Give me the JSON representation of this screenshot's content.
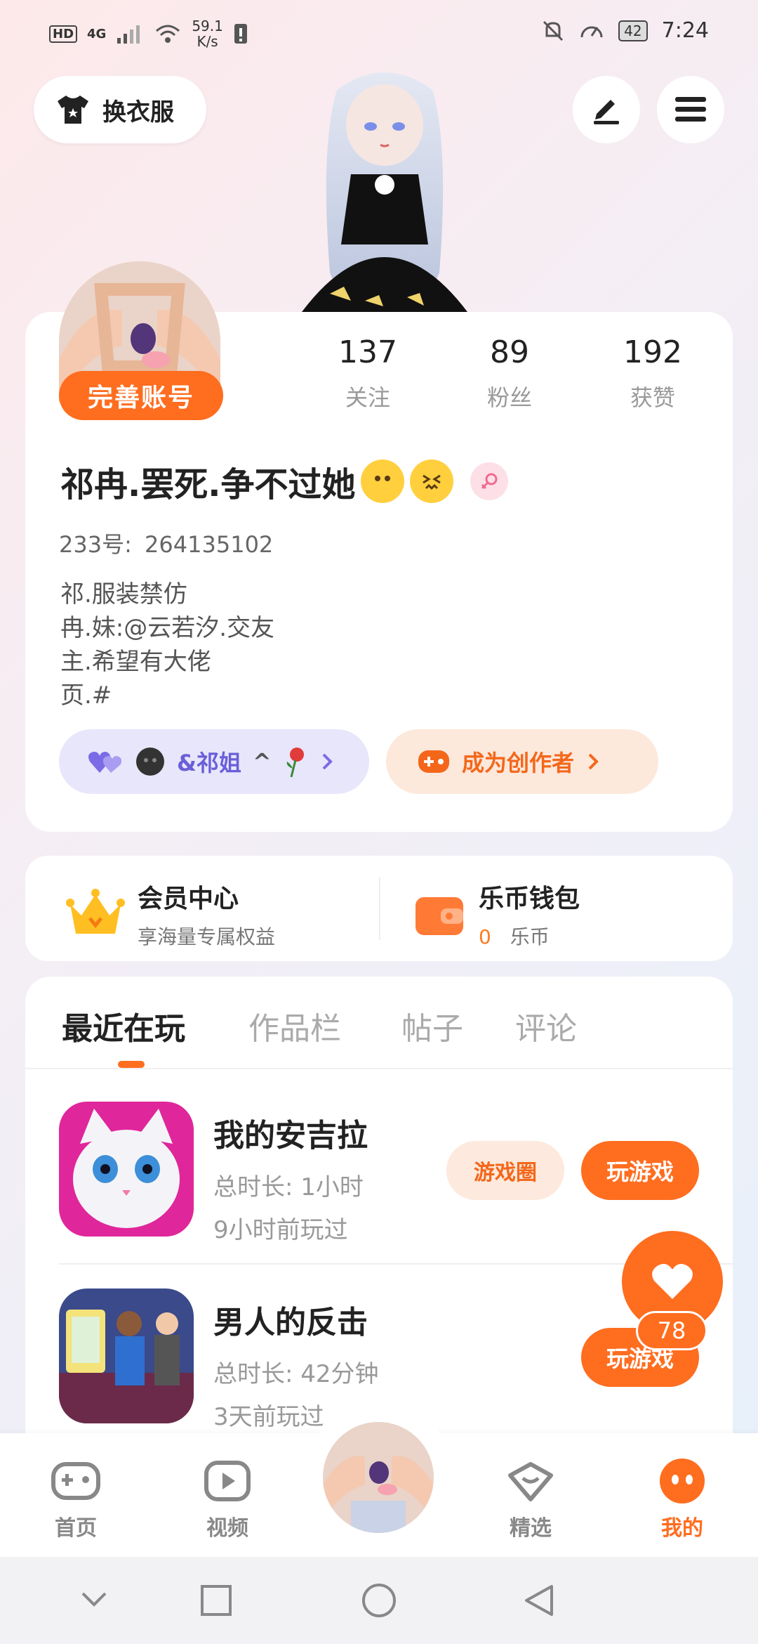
{
  "status_bar": {
    "hd": "HD",
    "network": "4G",
    "speed_value": "59.1",
    "speed_unit": "K/s",
    "battery": "42",
    "time": "7:24"
  },
  "top_bar": {
    "outfit_label": "换衣服"
  },
  "profile": {
    "complete_account_label": "完善账号",
    "stats": [
      {
        "value": "137",
        "label": "关注"
      },
      {
        "value": "89",
        "label": "粉丝"
      },
      {
        "value": "192",
        "label": "获赞"
      }
    ],
    "name": "祁冉.罢死.争不过她",
    "uid_label": "233号:",
    "uid_value": "264135102",
    "bio": "祁.服装禁仿\n冉.妹:@云若汐.交友\n主.希望有大佬\n页.#",
    "relation_label": "&祁姐",
    "relation_suffix": "^",
    "creator_label": "成为创作者"
  },
  "wallet_card": {
    "vip_title": "会员中心",
    "vip_sub": "享海量专属权益",
    "wallet_title": "乐币钱包",
    "wallet_amount": "0",
    "wallet_unit": "乐币"
  },
  "tabs": [
    "最近在玩",
    "作品栏",
    "帖子",
    "评论"
  ],
  "games": [
    {
      "title": "我的安吉拉",
      "duration": "总时长: 1小时",
      "last_played": "9小时前玩过",
      "circle_label": "游戏圈",
      "play_label": "玩游戏"
    },
    {
      "title": "男人的反击",
      "duration": "总时长: 42分钟",
      "last_played": "3天前玩过",
      "play_label": "玩游戏"
    }
  ],
  "like_count": "78",
  "bottom_nav": [
    {
      "label": "首页",
      "icon": "gamepad-icon"
    },
    {
      "label": "视频",
      "icon": "play-icon"
    },
    {
      "label": "",
      "icon": "avatar"
    },
    {
      "label": "精选",
      "icon": "heart-box-icon"
    },
    {
      "label": "我的",
      "icon": "face-icon"
    }
  ],
  "colors": {
    "accent": "#ff6d1f",
    "purple": "#6a5fd8"
  }
}
